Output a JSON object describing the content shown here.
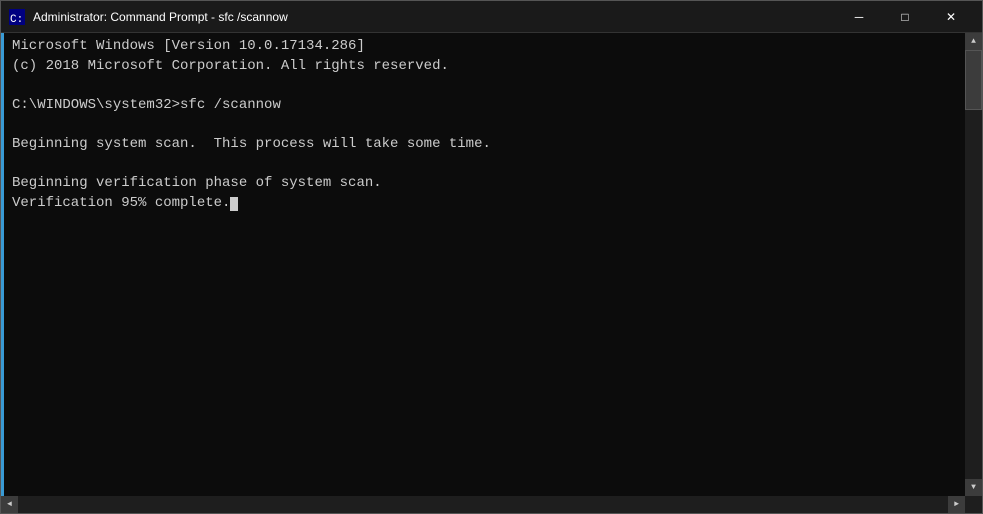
{
  "titleBar": {
    "icon": "cmd-icon",
    "title": "Administrator: Command Prompt - sfc /scannow",
    "minimizeLabel": "─",
    "maximizeLabel": "□",
    "closeLabel": "✕"
  },
  "terminal": {
    "lines": [
      "Microsoft Windows [Version 10.0.17134.286]",
      "(c) 2018 Microsoft Corporation. All rights reserved.",
      "",
      "C:\\WINDOWS\\system32>sfc /scannow",
      "",
      "Beginning system scan.  This process will take some time.",
      "",
      "Beginning verification phase of system scan.",
      "Verification 95% complete."
    ],
    "cursorVisible": true
  },
  "scrollbar": {
    "upArrow": "▲",
    "downArrow": "▼",
    "leftArrow": "◄",
    "rightArrow": "►"
  }
}
